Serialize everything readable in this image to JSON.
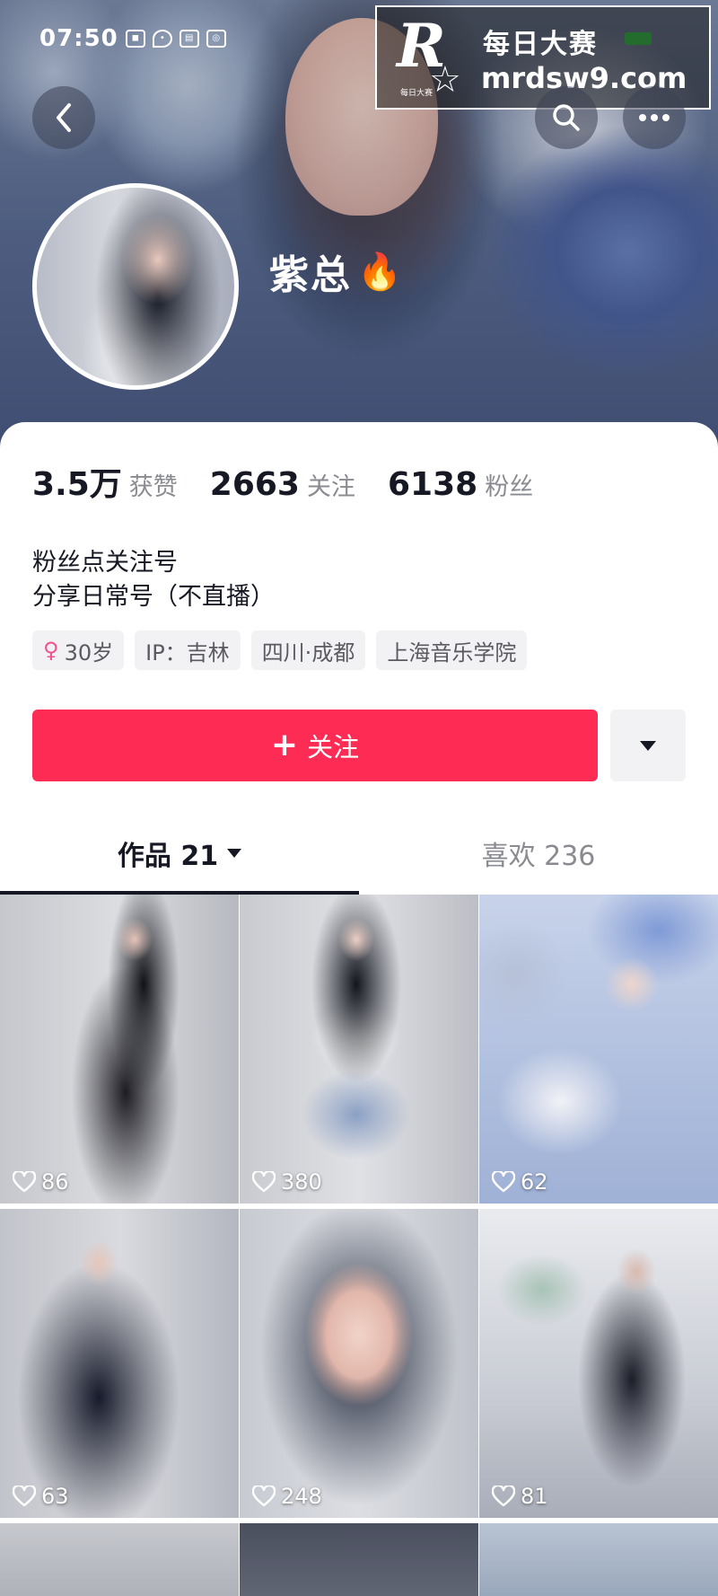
{
  "status_bar": {
    "time": "07:50"
  },
  "watermark": {
    "logo_letter": "R",
    "logo_small_text": "每日大赛",
    "title": "每日大赛",
    "url": "mrdsw9.com"
  },
  "header": {
    "back_icon": "chevron-left-icon",
    "search_icon": "search-icon",
    "more_icon": "more-horizontal-icon"
  },
  "profile": {
    "nickname": "紫总",
    "nickname_emoji": "🔥",
    "stats": [
      {
        "value": "3.5万",
        "label": "获赞"
      },
      {
        "value": "2663",
        "label": "关注"
      },
      {
        "value": "6138",
        "label": "粉丝"
      }
    ],
    "bio_lines": [
      "粉丝点关注号",
      "分享日常号（不直播）"
    ],
    "tags": [
      {
        "text": "30岁",
        "icon": "female-icon"
      },
      {
        "text": "IP：吉林"
      },
      {
        "text": "四川·成都"
      },
      {
        "text": "上海音乐学院"
      }
    ]
  },
  "actions": {
    "follow_plus": "+",
    "follow_label": "关注",
    "follow_color": "#fe2c55"
  },
  "tabs": [
    {
      "label": "作品 21",
      "active": true
    },
    {
      "label": "喜欢 236",
      "active": false
    }
  ],
  "videos": [
    {
      "likes": "86"
    },
    {
      "likes": "380"
    },
    {
      "likes": "62"
    },
    {
      "likes": "63"
    },
    {
      "likes": "248"
    },
    {
      "likes": "81"
    }
  ]
}
